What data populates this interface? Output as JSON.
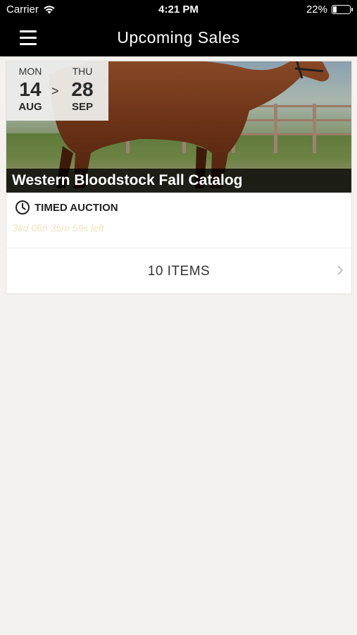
{
  "status_bar": {
    "carrier": "Carrier",
    "time": "4:21 PM",
    "battery": "22%",
    "battery_level": 0.22
  },
  "nav": {
    "title": "Upcoming Sales",
    "menu_icon": "hamburger-menu-icon"
  },
  "sale": {
    "start": {
      "dow": "MON",
      "day": "14",
      "month": "AUG"
    },
    "separator": ">",
    "end": {
      "dow": "THU",
      "day": "28",
      "month": "SEP"
    },
    "title": "Western Bloodstock Fall Catalog",
    "auction_type": "TIMED AUCTION",
    "time_left": "38d 06h 35m 59s left",
    "items_label": "10 ITEMS"
  },
  "colors": {
    "background": "#f3f2ee",
    "nav_bg": "#000000",
    "time_left_text": "#efe3bd"
  }
}
